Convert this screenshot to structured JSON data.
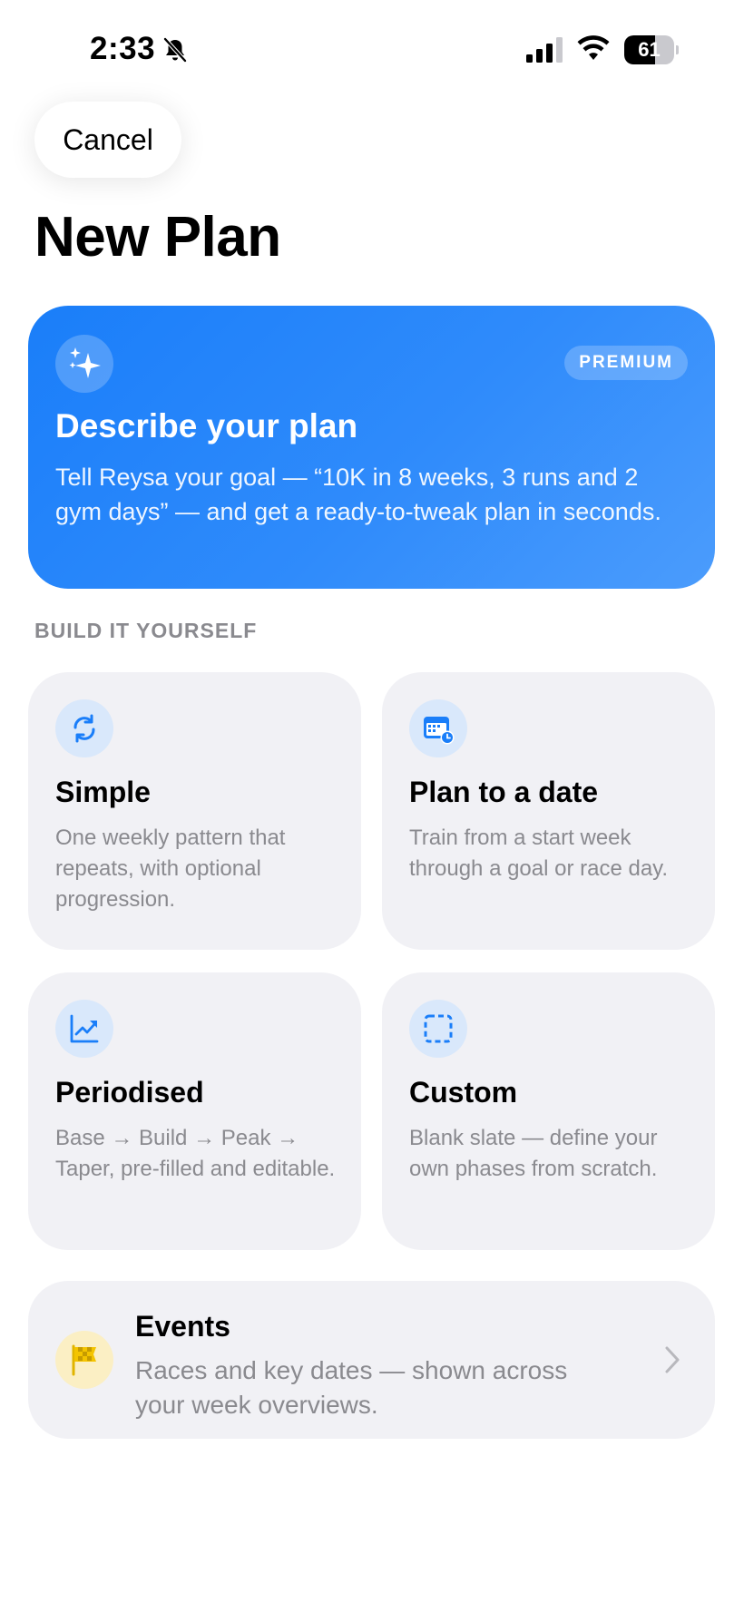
{
  "status_bar": {
    "time": "2:33",
    "battery_level": 61,
    "battery_text": "61",
    "icons": [
      "bell-slash-icon",
      "cellular-signal-icon",
      "wifi-icon",
      "battery-icon"
    ]
  },
  "nav": {
    "cancel_label": "Cancel",
    "title": "New Plan"
  },
  "premium_card": {
    "icon": "sparkles-icon",
    "badge": "PREMIUM",
    "title": "Describe your plan",
    "description": "Tell Reysa your goal — “10K in 8 weeks, 3 runs and 2 gym days” — and get a ready-to-tweak plan in seconds."
  },
  "build_section": {
    "header": "BUILD IT YOURSELF",
    "tiles": [
      {
        "icon": "repeat-arrows-icon",
        "title": "Simple",
        "description": "One weekly pattern that repeats, with optional progression."
      },
      {
        "icon": "calendar-clock-icon",
        "title": "Plan to a date",
        "description": "Train from a start week through a goal or race day."
      },
      {
        "icon": "trend-chart-icon",
        "title": "Periodised",
        "description": "Base → Build → Peak → Taper, pre-filled and editable."
      },
      {
        "icon": "dashed-square-icon",
        "title": "Custom",
        "description": "Blank slate — define your own phases from scratch."
      }
    ]
  },
  "events": {
    "icon": "checkered-flag-icon",
    "title": "Events",
    "description": "Races and key dates — shown across your week overviews.",
    "chevron": "chevron-right-icon"
  },
  "colors": {
    "accent": "#1a7ef9",
    "tile_background": "#f1f1f5",
    "icon_circle": "#d9e8fb",
    "events_icon_circle": "#fbefc4",
    "secondary_text": "#8a8a8f"
  }
}
